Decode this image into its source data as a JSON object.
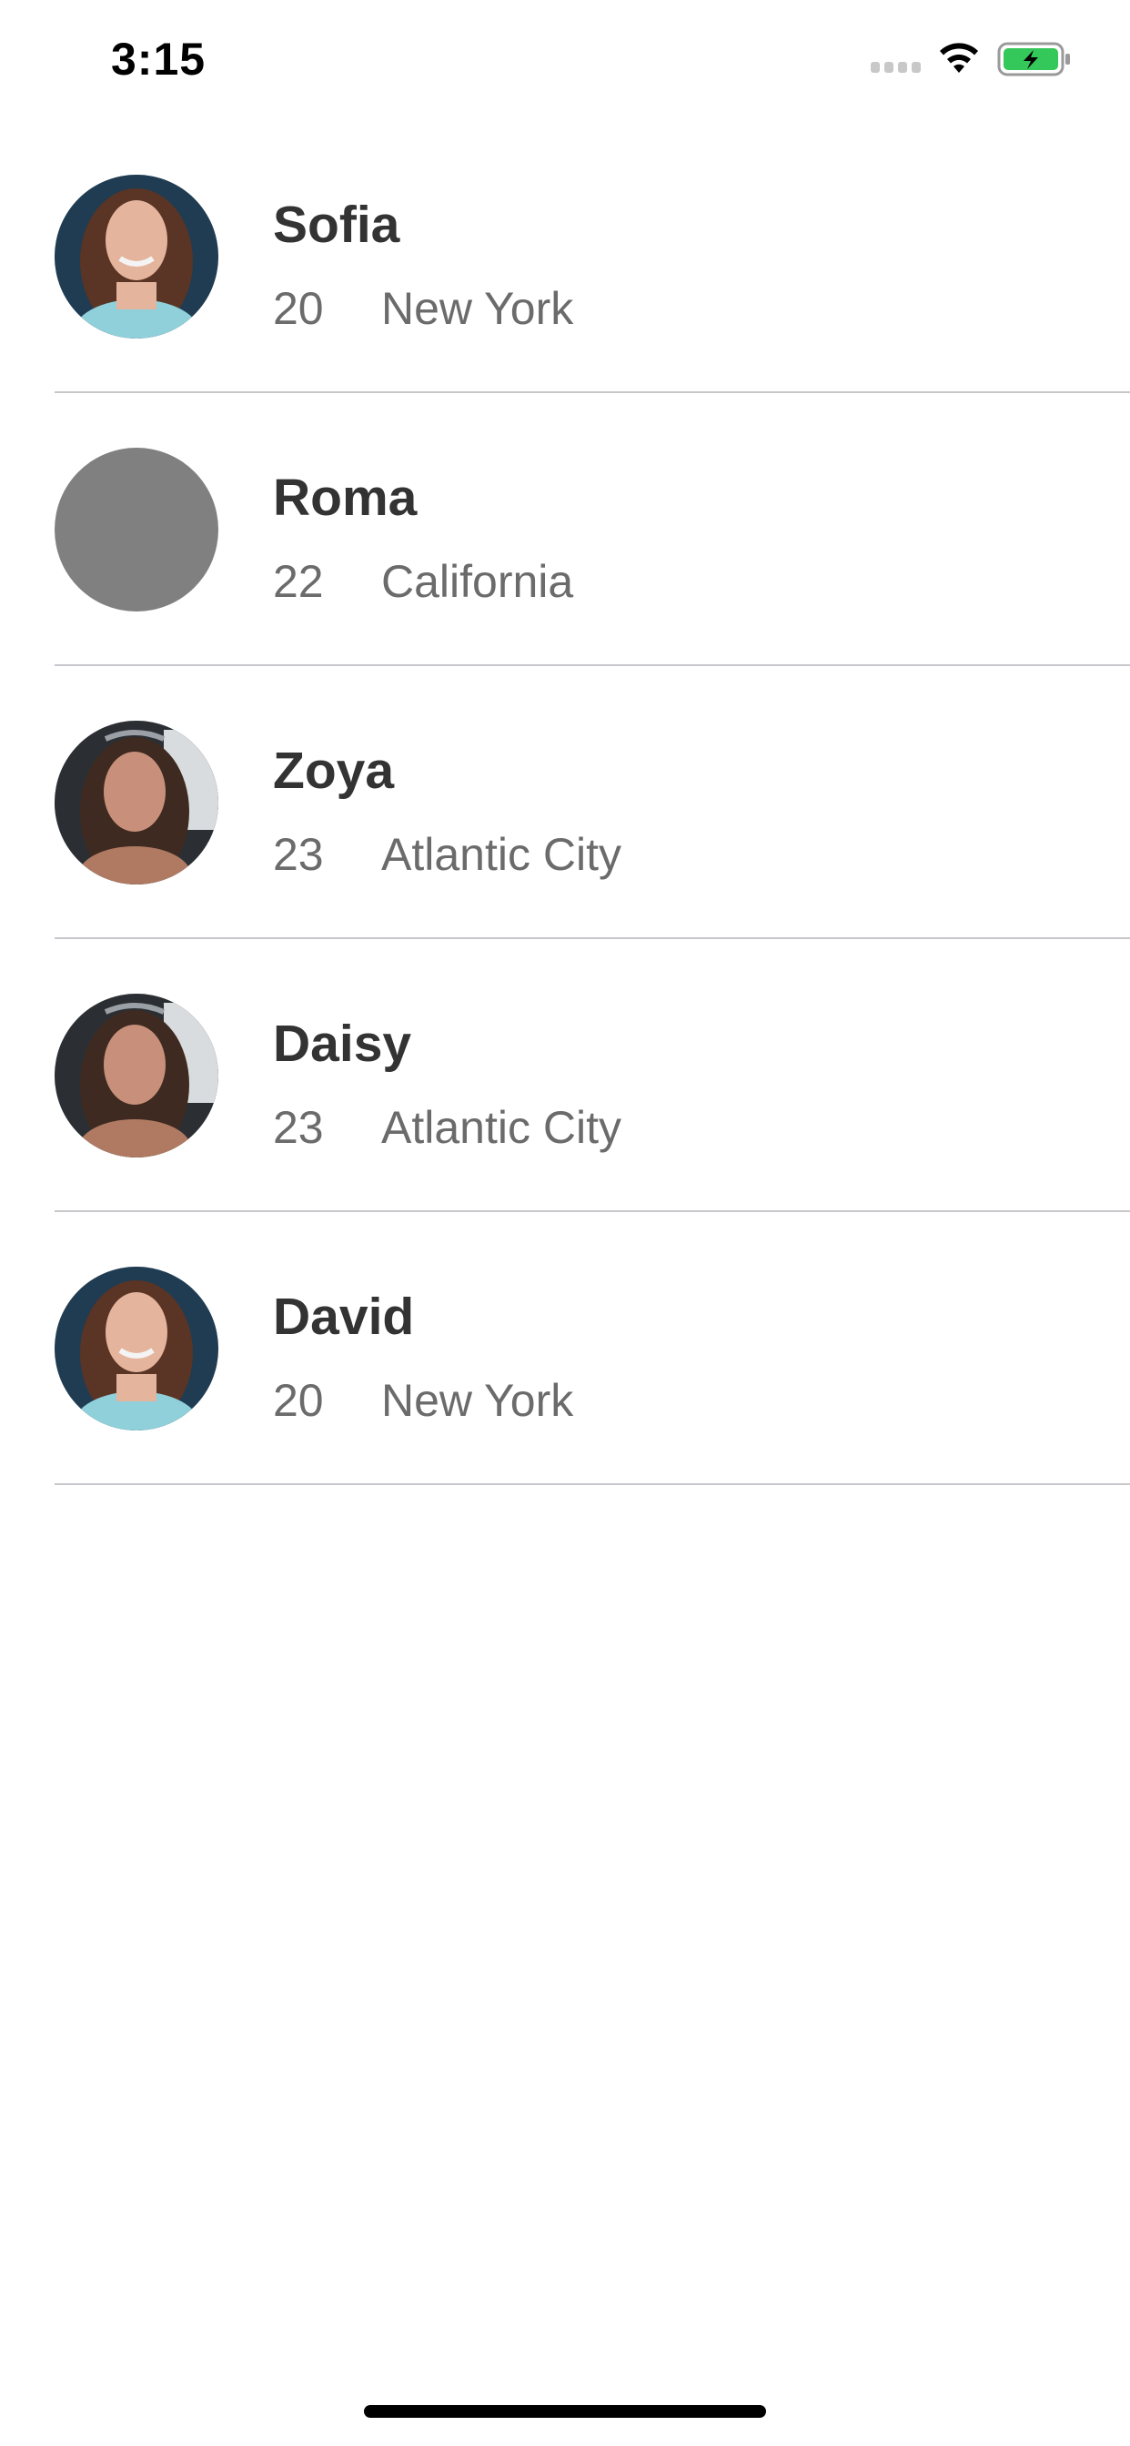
{
  "status_bar": {
    "time": "3:15",
    "battery_color": "#34c759"
  },
  "contacts": [
    {
      "name": "Sofia",
      "age": "20",
      "city": "New York",
      "avatar": "photo-blonde-teal-top"
    },
    {
      "name": "Roma",
      "age": "22",
      "city": "California",
      "avatar": "placeholder-gray"
    },
    {
      "name": "Zoya",
      "age": "23",
      "city": "Atlantic City",
      "avatar": "photo-brunette-car"
    },
    {
      "name": "Daisy",
      "age": "23",
      "city": "Atlantic City",
      "avatar": "photo-brunette-car"
    },
    {
      "name": "David",
      "age": "20",
      "city": "New York",
      "avatar": "photo-blonde-teal-top"
    }
  ]
}
